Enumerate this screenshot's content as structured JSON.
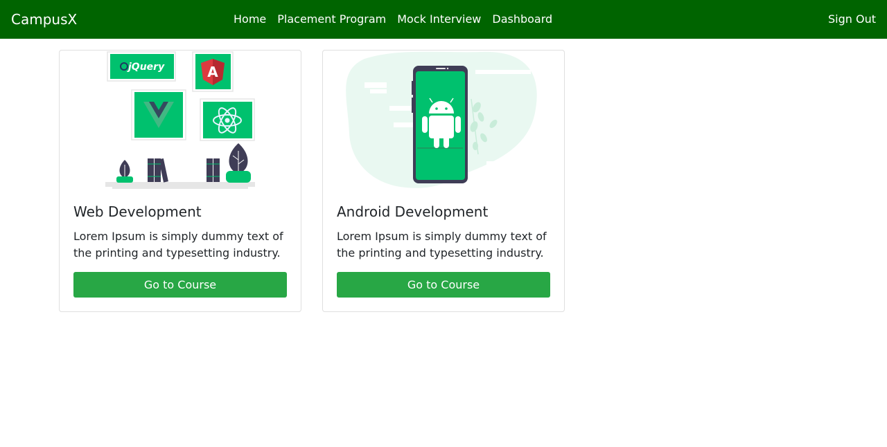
{
  "navbar": {
    "brand": "CampusX",
    "links": [
      {
        "label": "Home"
      },
      {
        "label": "Placement Program"
      },
      {
        "label": "Mock Interview"
      },
      {
        "label": "Dashboard"
      }
    ],
    "sign_out": "Sign Out",
    "background": "#006400"
  },
  "courses": [
    {
      "title": "Web Development",
      "description": "Lorem Ipsum is simply dummy text of the printing and typesetting industry.",
      "button_label": "Go to Course",
      "illustration": {
        "icons": [
          "jquery-logo-icon",
          "angular-logo-icon",
          "vue-logo-icon",
          "react-logo-icon",
          "plant-icon",
          "books-icon"
        ],
        "jquery_text": "jQuery",
        "angular_letter": "A"
      }
    },
    {
      "title": "Android Development",
      "description": "Lorem Ipsum is simply dummy text of the printing and typesetting industry.",
      "button_label": "Go to Course",
      "illustration": {
        "icons": [
          "smartphone-icon",
          "android-robot-icon",
          "leaves-icon"
        ]
      }
    }
  ],
  "colors": {
    "accent_green": "#00c16e",
    "button_green": "#28a745",
    "dark_slate": "#3f3d56"
  }
}
